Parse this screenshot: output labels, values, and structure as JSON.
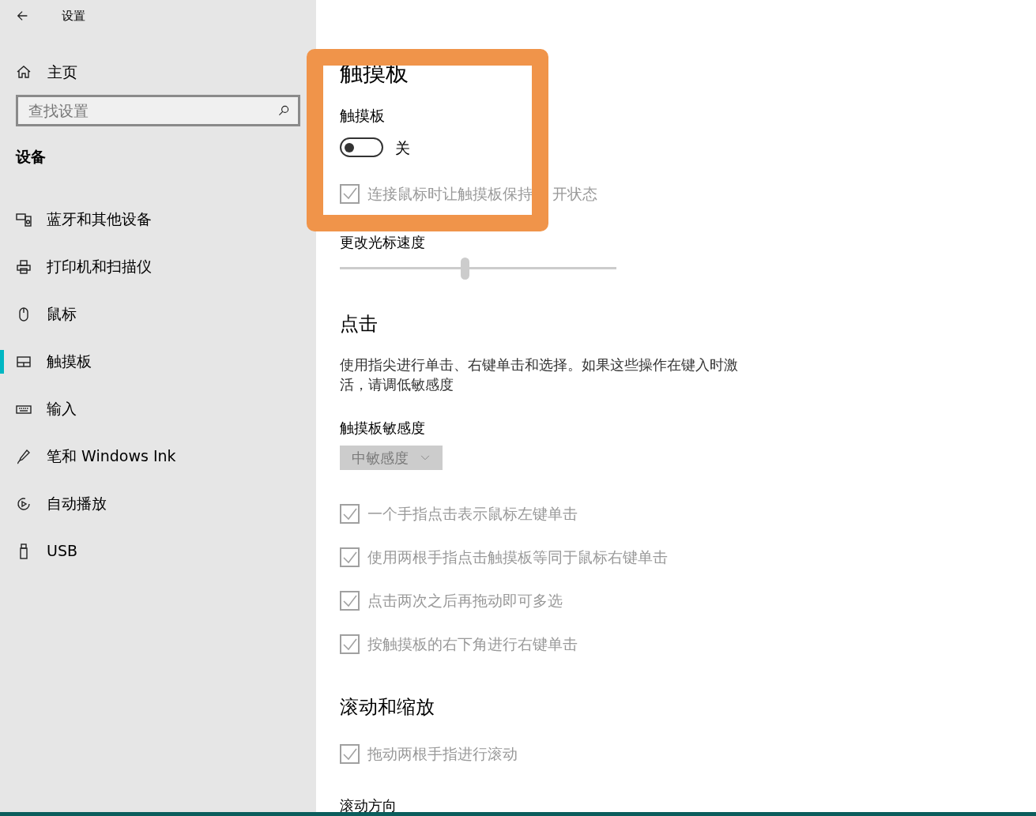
{
  "window": {
    "title": "设置"
  },
  "sidebar": {
    "home": "主页",
    "search": {
      "placeholder": "查找设置"
    },
    "section": "设备",
    "items": [
      {
        "label": "蓝牙和其他设备",
        "selected": false
      },
      {
        "label": "打印机和扫描仪",
        "selected": false
      },
      {
        "label": "鼠标",
        "selected": false
      },
      {
        "label": "触摸板",
        "selected": true
      },
      {
        "label": "输入",
        "selected": false
      },
      {
        "label": "笔和 Windows Ink",
        "selected": false
      },
      {
        "label": "自动播放",
        "selected": false
      },
      {
        "label": "USB",
        "selected": false
      }
    ]
  },
  "page": {
    "title": "触摸板",
    "toggle": {
      "label": "触摸板",
      "on": false,
      "state_text": "关"
    },
    "keep_on": {
      "label": "连接鼠标时让触摸板保持",
      "label_after_overlay": "开状态",
      "checked": true,
      "disabled": true
    },
    "cursor_speed": {
      "label": "更改光标速度",
      "level": 0.45
    },
    "taps": {
      "heading": "点击",
      "description": "使用指尖进行单击、右键单击和选择。如果这些操作在键入时激活，请调低敏感度",
      "sensitivity_label": "触摸板敏感度",
      "sensitivity_value": "中敏感度",
      "options": [
        {
          "label": "一个手指点击表示鼠标左键单击",
          "checked": true,
          "disabled": true
        },
        {
          "label": "使用两根手指点击触摸板等同于鼠标右键单击",
          "checked": true,
          "disabled": true
        },
        {
          "label": "点击两次之后再拖动即可多选",
          "checked": true,
          "disabled": true
        },
        {
          "label": "按触摸板的右下角进行右键单击",
          "checked": true,
          "disabled": true
        }
      ]
    },
    "scroll": {
      "heading": "滚动和缩放",
      "options": [
        {
          "label": "拖动两根手指进行滚动",
          "checked": true,
          "disabled": true
        }
      ],
      "next_label": "滚动方向"
    }
  }
}
